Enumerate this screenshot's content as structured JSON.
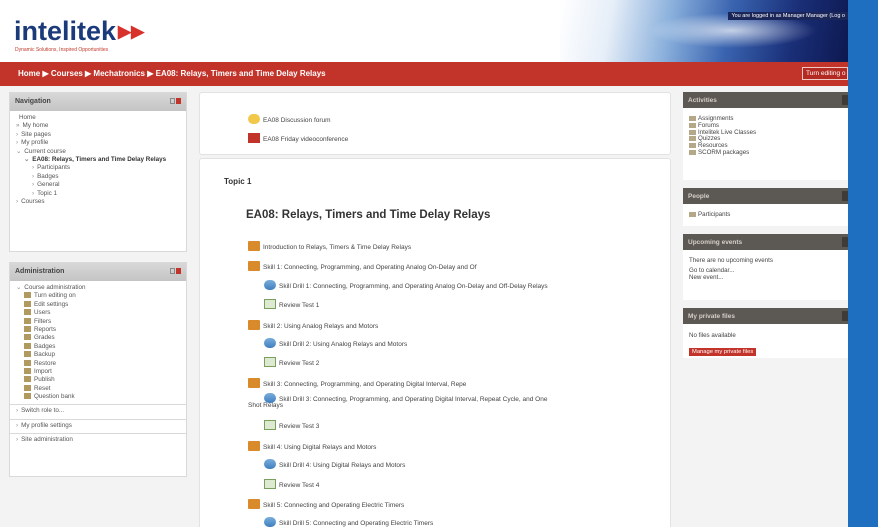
{
  "header": {
    "logo_text": "intelitek",
    "logo_arrows": "▶▶",
    "tagline": "Dynamic Solutions, Inspired Opportunities",
    "login_status": "You are logged in as Manager Manager (Log o"
  },
  "breadcrumb": {
    "text": "Home ▶ Courses ▶ Mechatronics ▶ EA08: Relays, Timers and Time Delay Relays"
  },
  "turn_editing_button": "Turn editing o",
  "navigation": {
    "title": "Navigation",
    "items": [
      {
        "label": "Home",
        "arrow": ""
      },
      {
        "label": "My home",
        "arrow": "»"
      },
      {
        "label": "Site pages",
        "arrow": "›"
      },
      {
        "label": "My profile",
        "arrow": "›"
      },
      {
        "label": "Current course",
        "arrow": "⌄"
      },
      {
        "label": "EA08: Relays, Timers and Time Delay Relays",
        "arrow": "⌄"
      },
      {
        "label": "Participants",
        "arrow": "›"
      },
      {
        "label": "Badges",
        "arrow": "›"
      },
      {
        "label": "General",
        "arrow": "›"
      },
      {
        "label": "Topic 1",
        "arrow": "›"
      },
      {
        "label": "Courses",
        "arrow": "›"
      }
    ]
  },
  "administration": {
    "title": "Administration",
    "course_admin": "Course administration",
    "items": [
      "Turn editing on",
      "Edit settings",
      "Users",
      "Filters",
      "Reports",
      "Grades",
      "Badges",
      "Backup",
      "Restore",
      "Import",
      "Publish",
      "Reset",
      "Question bank"
    ],
    "extra": [
      "Switch role to...",
      "My profile settings",
      "Site administration"
    ]
  },
  "general_section": {
    "items": [
      {
        "label": "EA08 Discussion forum",
        "icon": "forum-icon"
      },
      {
        "label": "EA08 Friday videoconference",
        "icon": "video-icon"
      }
    ]
  },
  "topic": {
    "label": "Topic 1",
    "title": "EA08: Relays, Timers and Time Delay Relays",
    "items": [
      {
        "label": "Introduction to Relays, Timers & Time Delay Relays",
        "type": "lesson"
      },
      {
        "label": "Skill 1: Connecting, Programming, and Operating Analog On-Delay and Of",
        "type": "lesson"
      },
      {
        "label": "Skill Drill 1: Connecting, Programming, and Operating Analog On-Delay and Off-Delay Relays",
        "type": "drill"
      },
      {
        "label": "Review Test 1",
        "type": "quiz"
      },
      {
        "label": "Skill 2: Using Analog Relays and Motors",
        "type": "lesson"
      },
      {
        "label": "Skill Drill 2: Using Analog Relays and Motors",
        "type": "drill"
      },
      {
        "label": "Review Test 2",
        "type": "quiz"
      },
      {
        "label": "Skill 3: Connecting, Programming, and Operating Digital Interval, Repe",
        "type": "lesson"
      },
      {
        "label": "Skill Drill 3: Connecting, Programming, and Operating Digital Interval, Repeat Cycle, and One",
        "label2": "Shot Relays",
        "type": "drill"
      },
      {
        "label": "Review Test 3",
        "type": "quiz"
      },
      {
        "label": "Skill 4: Using Digital Relays and Motors",
        "type": "lesson"
      },
      {
        "label": "Skill Drill 4: Using Digital Relays and Motors",
        "type": "drill"
      },
      {
        "label": "Review Test 4",
        "type": "quiz"
      },
      {
        "label": "Skill 5: Connecting and Operating Electric Timers",
        "type": "lesson"
      },
      {
        "label": "Skill Drill 5: Connecting and Operating Electric Timers",
        "type": "drill"
      }
    ]
  },
  "activities": {
    "title": "Activities",
    "items": [
      "Assignments",
      "Forums",
      "Intelitek Live Classes",
      "Quizzes",
      "Resources",
      "SCORM packages"
    ]
  },
  "people": {
    "title": "People",
    "item": "Participants"
  },
  "upcoming": {
    "title": "Upcoming events",
    "text": "There are no upcoming events",
    "calendar_link": "Go to calendar...",
    "new_event_link": "New event..."
  },
  "private_files": {
    "title": "My private files",
    "text": "No files available",
    "manage_button": "Manage my private files"
  }
}
